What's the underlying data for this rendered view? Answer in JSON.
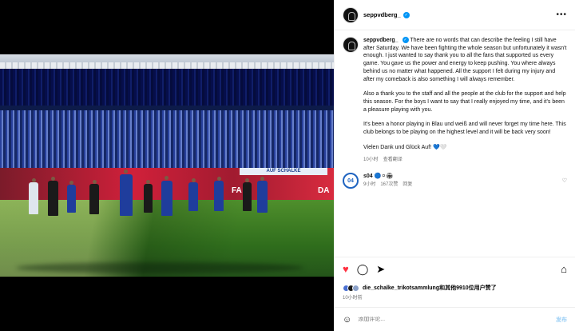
{
  "post": {
    "username": "seppvdberg_",
    "caption_paragraphs": [
      "There are no words that can describe the feeling I still have after Saturday. We have been fighting the whole season but unfortunately it wasn't enough. I just wanted to say thank you to all the fans that supported us every game. You gave us the power and energy to keep pushing. You where always behind us no matter what happened. All the support I felt during my injury and after my comeback is also something I will always remember.",
      "Also a thank you to the staff and all the people at the club for the support and help this season. For the boys I want to say that I really enjoyed my time, and it's been a pleasure playing with you.",
      "It's been a honor playing in Blau und weiß and will never forget my time here. This club belongs to be playing on the highest level and it will be back very soon!",
      "Vielen Dank und Glück Auf! 💙🤍"
    ],
    "caption_time": "10小时",
    "see_translation": "查看翻译"
  },
  "photo": {
    "ad_left": "FA",
    "ad_right": "DA",
    "banner": "AUF SCHALKE"
  },
  "comment": {
    "username": "s04",
    "text": "🔵⚪🏟",
    "time": "9小时",
    "likes": "167次赞",
    "reply": "回复"
  },
  "actions": {
    "liked_by_user": "die_schalke_trikotsammlung",
    "liked_by_rest": "和其他9910位用户赞了",
    "time": "10小时前"
  },
  "add_comment": {
    "placeholder": "添加评论...",
    "post_label": "发布"
  },
  "colors": {
    "heart": "#ff3040",
    "verified": "#0095f6",
    "schalke_blue": "#1f64c0"
  }
}
